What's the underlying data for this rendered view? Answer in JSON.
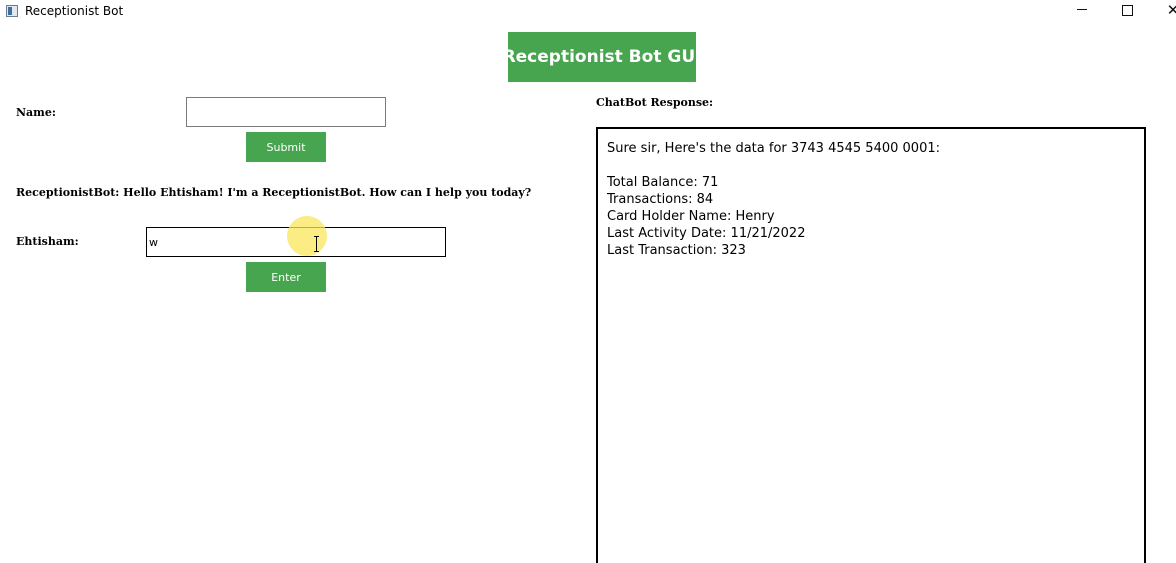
{
  "window": {
    "title": "Receptionist Bot",
    "minimize_glyph": "",
    "close_glyph": "✕"
  },
  "header": {
    "title": "Receptionist Bot GUI"
  },
  "form": {
    "name_label": "Name:",
    "name_value": "",
    "submit_label": "Submit",
    "bot_greeting": "ReceptionistBot: Hello Ehtisham! I'm a ReceptionistBot. How can I help you today?",
    "user_label": "Ehtisham:",
    "chat_value": "w",
    "enter_label": "Enter"
  },
  "response": {
    "label": "ChatBot Response:",
    "lines": [
      "Sure sir, Here's the data for 3743 4545 5400 0001:",
      "",
      "Total Balance: 71",
      "Transactions: 84",
      "Card Holder Name: Henry",
      "Last Activity Date: 11/21/2022",
      "Last Transaction: 323"
    ]
  },
  "colors": {
    "accent_green": "#48a54f",
    "cursor_highlight": "#fae65a"
  },
  "icons": {
    "app": "app-window-icon",
    "minimize": "minimize-icon",
    "maximize": "maximize-icon",
    "close": "close-icon",
    "cursor": "text-cursor-icon"
  }
}
